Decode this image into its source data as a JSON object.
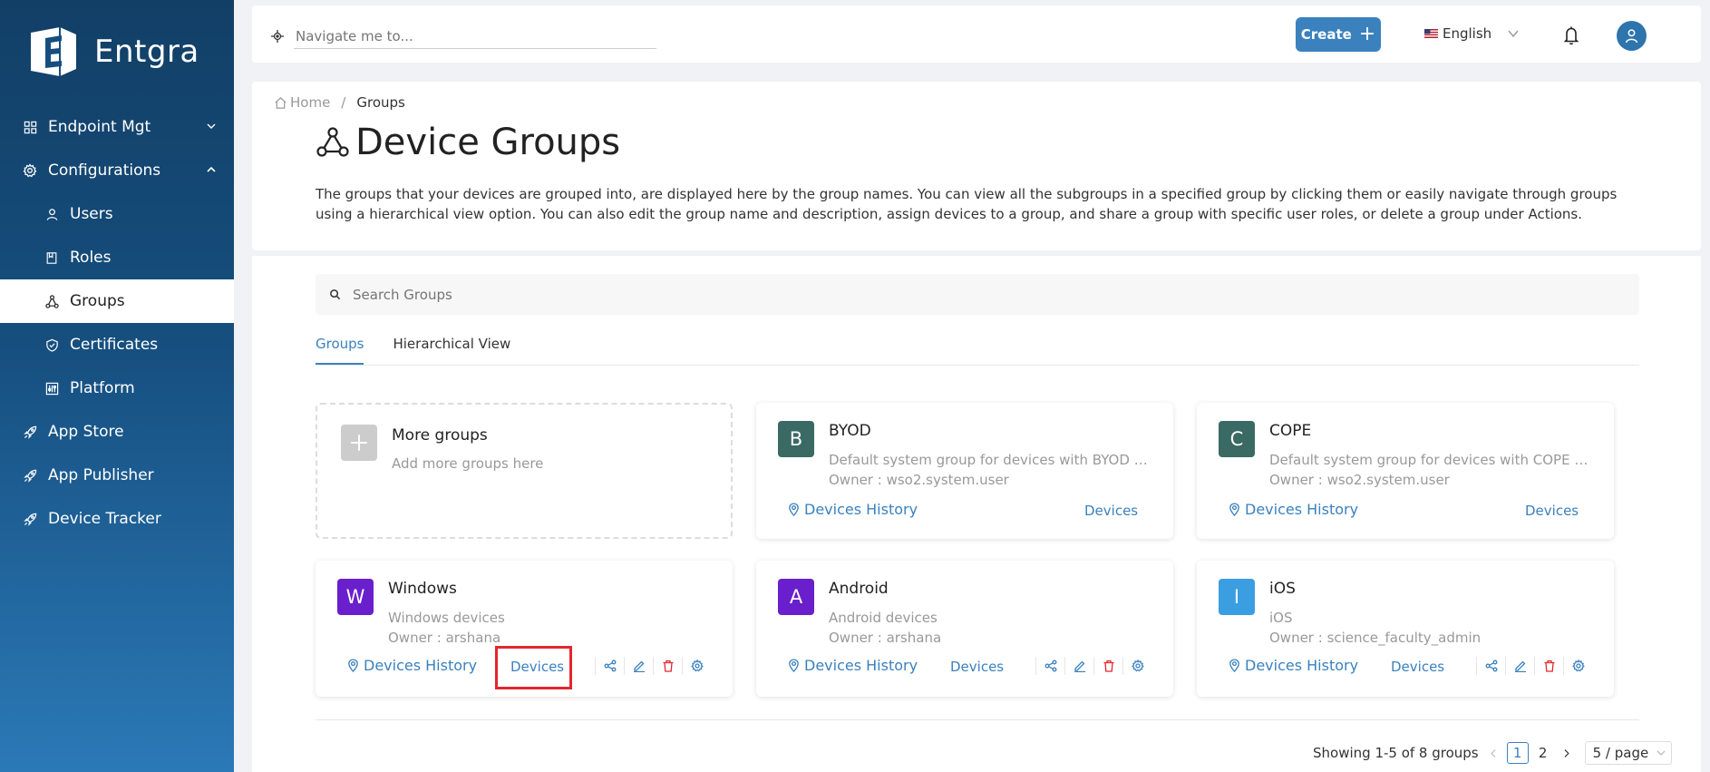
{
  "brand": {
    "name": "Entgra"
  },
  "sidebar": {
    "items": [
      {
        "label": "Endpoint Mgt"
      },
      {
        "label": "Configurations"
      },
      {
        "label": "Users"
      },
      {
        "label": "Roles"
      },
      {
        "label": "Groups"
      },
      {
        "label": "Certificates"
      },
      {
        "label": "Platform"
      },
      {
        "label": "App Store"
      },
      {
        "label": "App Publisher"
      },
      {
        "label": "Device Tracker"
      }
    ]
  },
  "topbar": {
    "nav_placeholder": "Navigate me to...",
    "create_label": "Create",
    "language": "English"
  },
  "breadcrumb": {
    "home": "Home",
    "sep": "/",
    "current": "Groups"
  },
  "page": {
    "title": "Device Groups",
    "description": "The groups that your devices are grouped into, are displayed here by the group names. You can view all the subgroups in a specified group by clicking them or easily navigate through groups using a hierarchical view option. You can also edit the group name and description, assign devices to a group, and share a group with specific user roles, or delete a group under Actions."
  },
  "search": {
    "placeholder": "Search Groups"
  },
  "tabs": [
    {
      "label": "Groups"
    },
    {
      "label": "Hierarchical View"
    }
  ],
  "more_groups": {
    "title": "More groups",
    "subtitle": "Add more groups here"
  },
  "groups": [
    {
      "letter": "B",
      "name": "BYOD",
      "description": "Default system group for devices with BYOD ownership",
      "owner": "Owner : wso2.system.user",
      "history": "Devices History",
      "devices": "Devices",
      "color": "#3a6a63"
    },
    {
      "letter": "C",
      "name": "COPE",
      "description": "Default system group for devices with COPE ownership",
      "owner": "Owner : wso2.system.user",
      "history": "Devices History",
      "devices": "Devices",
      "color": "#3a6a63"
    },
    {
      "letter": "W",
      "name": "Windows",
      "description": "Windows devices",
      "owner": "Owner : arshana",
      "history": "Devices History",
      "devices": "Devices",
      "color": "#6a1fcc"
    },
    {
      "letter": "A",
      "name": "Android",
      "description": "Android devices",
      "owner": "Owner : arshana",
      "history": "Devices History",
      "devices": "Devices",
      "color": "#6a1fcc"
    },
    {
      "letter": "I",
      "name": "iOS",
      "description": "iOS",
      "owner": "Owner : science_faculty_admin",
      "history": "Devices History",
      "devices": "Devices",
      "color": "#3a9ee0"
    }
  ],
  "pagination": {
    "summary": "Showing 1-5 of 8 groups",
    "pages": [
      "1",
      "2"
    ],
    "page_size": "5 / page"
  },
  "colors": {
    "primary": "#3a81be",
    "danger": "#e3262e",
    "sidebar_top": "#123f66",
    "sidebar_bottom": "#2b79b7"
  }
}
